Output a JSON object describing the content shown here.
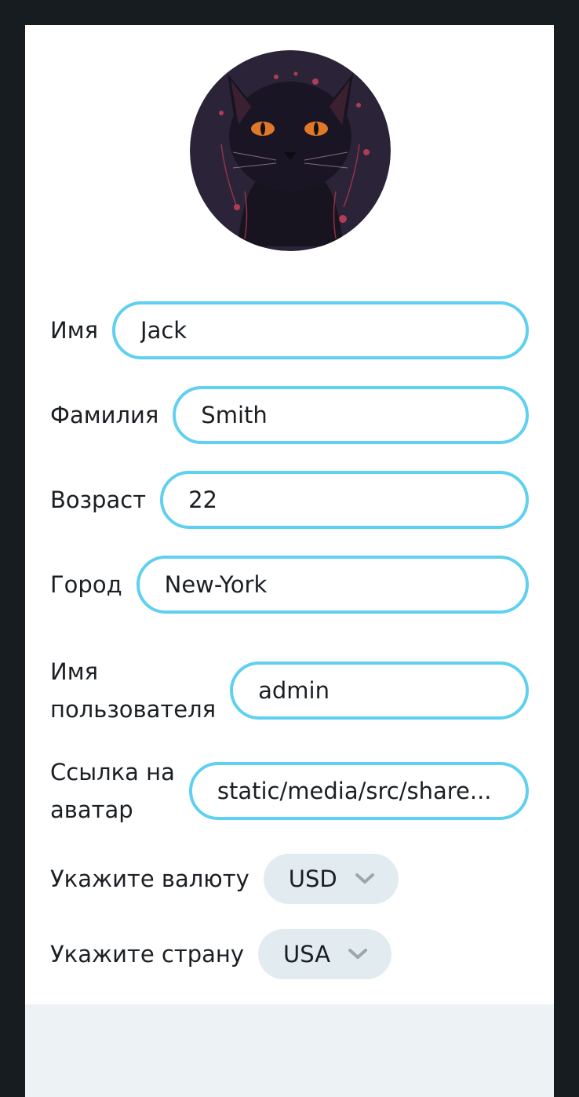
{
  "form": {
    "first_name": {
      "label": "Имя",
      "value": "Jack"
    },
    "last_name": {
      "label": "Фамилия",
      "value": "Smith"
    },
    "age": {
      "label": "Возраст",
      "value": "22"
    },
    "city": {
      "label": "Город",
      "value": "New-York"
    },
    "username": {
      "label_line1": "Имя",
      "label_line2": "пользователя",
      "value": "admin"
    },
    "avatar_link": {
      "label_line1": "Ссылка на",
      "label_line2": "аватар",
      "value": "static/media/src/share..."
    },
    "currency": {
      "label": "Укажите валюту",
      "value": "USD",
      "icon": "chevron-down-icon"
    },
    "country": {
      "label": "Укажите страну",
      "value": "USA",
      "icon": "chevron-down-icon"
    }
  },
  "colors": {
    "page_background": "#161c1f",
    "card": "#ffffff",
    "input_border": "#5fd0f0",
    "select_background": "#e2ecf0",
    "chevron": "#9aa7ad"
  }
}
